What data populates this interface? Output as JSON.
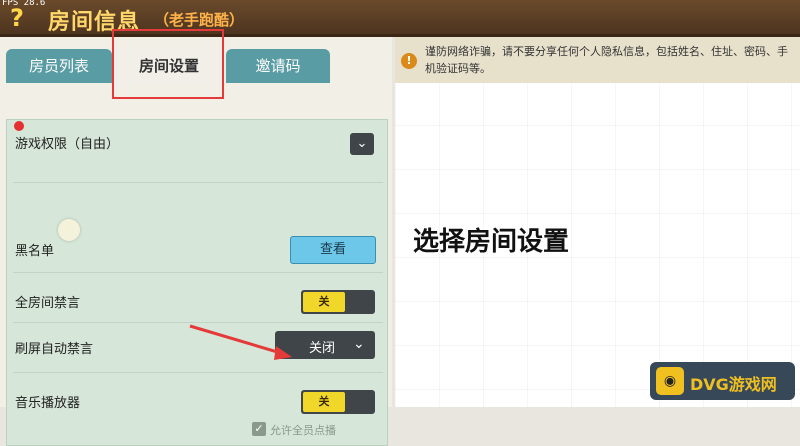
{
  "header": {
    "fps": "FPS 28.6",
    "title": "房间信息",
    "subtitle": "（老手跑酷）",
    "help_icon": "?"
  },
  "tabs": [
    {
      "label": "房员列表"
    },
    {
      "label": "房间设置"
    },
    {
      "label": "邀请码"
    }
  ],
  "settings": {
    "permission_label": "游戏权限（自由）",
    "blacklist_label": "黑名单",
    "blacklist_button": "查看",
    "mute_all_label": "全房间禁言",
    "mute_all_value": "关",
    "auto_mute_label": "刷屏自动禁言",
    "auto_mute_value": "关闭",
    "music_label": "音乐播放器",
    "music_value": "关",
    "allow_all_label": "允许全员点播"
  },
  "warning": {
    "text": "谨防网络诈骗，请不要分享任何个人隐私信息，包括姓名、住址、密码、手机验证码等。"
  },
  "overlay": {
    "text": "选择房间设置"
  },
  "watermark": {
    "text": "DVG游戏网"
  },
  "colors": {
    "accent": "#f0d72a",
    "tab": "#5a9ca4",
    "highlight": "#e43a3a"
  }
}
